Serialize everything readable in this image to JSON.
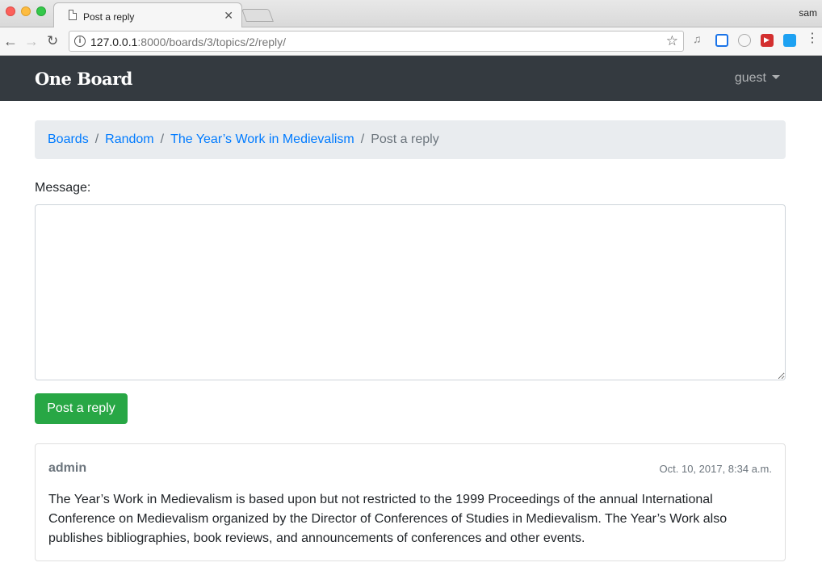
{
  "browser": {
    "tab_title": "Post a reply",
    "profile_name": "sam",
    "url_host": "127.0.0.1",
    "url_rest": ":8000/boards/3/topics/2/reply/"
  },
  "navbar": {
    "brand": "One Board",
    "user": "guest"
  },
  "breadcrumb": {
    "items": [
      "Boards",
      "Random",
      "The Year’s Work in Medievalism"
    ],
    "active": "Post a reply",
    "separator": "/"
  },
  "form": {
    "message_label": "Message:",
    "message_value": "",
    "submit_label": "Post a reply"
  },
  "post": {
    "author": "admin",
    "date": "Oct. 10, 2017, 8:34 a.m.",
    "body": "The Year’s Work in Medievalism is based upon but not restricted to the 1999 Proceedings of the annual International Conference on Medievalism organized by the Director of Conferences of Studies in Medievalism. The Year’s Work also publishes bibliographies, book reviews, and announcements of conferences and other events."
  },
  "colors": {
    "navbar_bg": "#343a40",
    "link": "#007bff",
    "success": "#28a745",
    "muted": "#6c757d"
  },
  "icons": [
    "document-icon",
    "close-icon",
    "back-icon",
    "forward-icon",
    "reload-icon",
    "info-icon",
    "star-icon",
    "caret-down-icon",
    "menu-dots-icon"
  ]
}
